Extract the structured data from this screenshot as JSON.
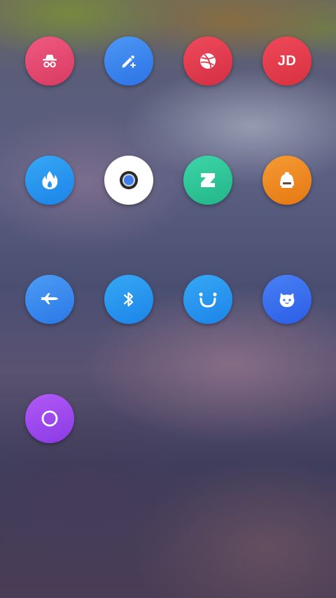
{
  "home_screen": {
    "apps": [
      {
        "icon": "incognito-icon",
        "color": "#e0486e"
      },
      {
        "icon": "pencil-plus-icon",
        "color": "#3a86f0"
      },
      {
        "icon": "dribbble-icon",
        "color": "#e03a4c"
      },
      {
        "icon": "jd-icon",
        "label": "JD",
        "color": "#e23a4a"
      },
      {
        "icon": "flame-icon",
        "color": "#2496f0"
      },
      {
        "icon": "camera-lens-icon",
        "color": "#ffffff"
      },
      {
        "icon": "deviantart-icon",
        "color": "#2ec99a"
      },
      {
        "icon": "robot-helmet-icon",
        "color": "#f08a22"
      },
      {
        "icon": "airplane-icon",
        "color": "#3a8df0"
      },
      {
        "icon": "bluetooth-icon",
        "color": "#2496f0"
      },
      {
        "icon": "smile-icon",
        "color": "#2496f0"
      },
      {
        "icon": "mi-bunny-icon",
        "color": "#3a6ef0"
      },
      {
        "icon": "circle-ring-icon",
        "color": "#9b4bf0"
      }
    ]
  }
}
